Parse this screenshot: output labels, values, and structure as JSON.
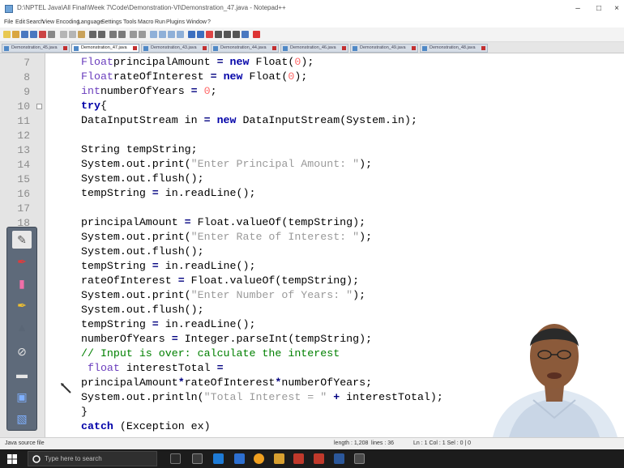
{
  "window": {
    "title": "D:\\NPTEL Java\\All Final\\Week 7\\Code\\Demonstration-VI\\Demonstration_47.java - Notepad++",
    "min": "–",
    "max": "□",
    "close": "×"
  },
  "menu": [
    "File",
    "Edit",
    "Search",
    "View",
    "Encoding",
    "Language",
    "Settings",
    "Tools",
    "Macro",
    "Run",
    "Plugins",
    "Window",
    "?"
  ],
  "tabs": [
    {
      "label": "Demonstration_45.java"
    },
    {
      "label": "Demonstration_47.java"
    },
    {
      "label": "Demonstration_43.java"
    },
    {
      "label": "Demonstration_44.java"
    },
    {
      "label": "Demonstration_46.java"
    },
    {
      "label": "Demonstration_49.java"
    },
    {
      "label": "Demonstration_48.java"
    }
  ],
  "lines": [
    {
      "n": "7",
      "code": [
        [
          "ty",
          "Float"
        ],
        [
          "",
          "principalAmount "
        ],
        [
          "op",
          "="
        ],
        [
          "",
          " "
        ],
        [
          "kw",
          "new"
        ],
        [
          "",
          " Float("
        ],
        [
          "num",
          "0"
        ],
        [
          "",
          ");"
        ]
      ]
    },
    {
      "n": "8",
      "code": [
        [
          "ty",
          "Float"
        ],
        [
          "",
          "rateOfInterest "
        ],
        [
          "op",
          "="
        ],
        [
          "",
          " "
        ],
        [
          "kw",
          "new"
        ],
        [
          "",
          " Float("
        ],
        [
          "num",
          "0"
        ],
        [
          "",
          ");"
        ]
      ]
    },
    {
      "n": "9",
      "code": [
        [
          "ty",
          "int"
        ],
        [
          "",
          "numberOfYears "
        ],
        [
          "op",
          "="
        ],
        [
          "",
          " "
        ],
        [
          "num",
          "0"
        ],
        [
          "",
          ";"
        ]
      ]
    },
    {
      "n": "10",
      "code": [
        [
          "kw",
          "try"
        ],
        [
          "",
          "{"
        ]
      ]
    },
    {
      "n": "11",
      "code": [
        [
          "",
          "DataInputStream in "
        ],
        [
          "op",
          "="
        ],
        [
          "",
          " "
        ],
        [
          "kw",
          "new"
        ],
        [
          "",
          " DataInputStream(System.in);"
        ]
      ]
    },
    {
      "n": "12",
      "code": []
    },
    {
      "n": "13",
      "code": [
        [
          "",
          "String tempString;"
        ]
      ]
    },
    {
      "n": "14",
      "code": [
        [
          "",
          "System.out.print("
        ],
        [
          "str",
          "\"Enter Principal Amount: \""
        ],
        [
          "",
          ");"
        ]
      ]
    },
    {
      "n": "15",
      "code": [
        [
          "",
          "System.out.flush();"
        ]
      ]
    },
    {
      "n": "16",
      "code": [
        [
          "",
          "tempString "
        ],
        [
          "op",
          "="
        ],
        [
          "",
          " in.readLine();"
        ]
      ]
    },
    {
      "n": "17",
      "code": []
    },
    {
      "n": "18",
      "code": [
        [
          "",
          "principalAmount "
        ],
        [
          "op",
          "="
        ],
        [
          "",
          " Float.valueOf(tempString);"
        ]
      ]
    },
    {
      "n": "",
      "code": [
        [
          "",
          "System.out.print("
        ],
        [
          "str",
          "\"Enter Rate of Interest: \""
        ],
        [
          "",
          ");"
        ]
      ]
    },
    {
      "n": "",
      "code": [
        [
          "",
          "System.out.flush();"
        ]
      ]
    },
    {
      "n": "",
      "code": [
        [
          "",
          "tempString "
        ],
        [
          "op",
          "="
        ],
        [
          "",
          " in.readLine();"
        ]
      ]
    },
    {
      "n": "",
      "code": [
        [
          "",
          "rateOfInterest "
        ],
        [
          "op",
          "="
        ],
        [
          "",
          " Float.valueOf(tempString);"
        ]
      ]
    },
    {
      "n": "",
      "code": [
        [
          "",
          "System.out.print("
        ],
        [
          "str",
          "\"Enter Number of Years: \""
        ],
        [
          "",
          ");"
        ]
      ]
    },
    {
      "n": "",
      "code": [
        [
          "",
          "System.out.flush();"
        ]
      ]
    },
    {
      "n": "",
      "code": [
        [
          "",
          "tempString "
        ],
        [
          "op",
          "="
        ],
        [
          "",
          " in.readLine();"
        ]
      ]
    },
    {
      "n": "",
      "code": [
        [
          "",
          "numberOfYears "
        ],
        [
          "op",
          "="
        ],
        [
          "",
          " Integer.parseInt(tempString);"
        ]
      ]
    },
    {
      "n": "",
      "code": [
        [
          "cm",
          "// Input is over: calculate the interest"
        ]
      ]
    },
    {
      "n": "",
      "code": [
        [
          "",
          " "
        ],
        [
          "ty",
          "float"
        ],
        [
          "",
          " interestTotal "
        ],
        [
          "op",
          "="
        ]
      ]
    },
    {
      "n": "",
      "code": [
        [
          "",
          "principalAmount"
        ],
        [
          "op",
          "*"
        ],
        [
          "",
          "rateOfInterest"
        ],
        [
          "op",
          "*"
        ],
        [
          "",
          "numberOfYears;"
        ]
      ]
    },
    {
      "n": "",
      "code": [
        [
          "",
          "System.out.println("
        ],
        [
          "str",
          "\"Total Interest = \""
        ],
        [
          "",
          " "
        ],
        [
          "op",
          "+"
        ],
        [
          "",
          " interestTotal);"
        ]
      ]
    },
    {
      "n": "",
      "code": [
        [
          "",
          "}"
        ]
      ]
    },
    {
      "n": "",
      "code": [
        [
          "kw",
          "catch"
        ],
        [
          "",
          " (Exception ex)"
        ]
      ]
    }
  ],
  "status": {
    "type": "Java source file",
    "length": "length : 1,208",
    "lines": "lines : 36",
    "position": "Ln : 1    Col : 1    Sel : 0 | 0"
  },
  "taskbar": {
    "search_placeholder": "Type here to search"
  },
  "colors": {
    "keyword": "#0000a8",
    "type": "#6a3dbd",
    "number": "#ff6a6a",
    "string": "#9a9a9a",
    "comment": "#008000",
    "gutter": "#e4e4e4"
  },
  "palette_tools": [
    "note-icon",
    "red-pen-icon",
    "pink-highlighter-icon",
    "yellow-highlighter-icon",
    "eraser-icon",
    "clear-icon",
    "minimize-icon",
    "monitor-icon",
    "pen-settings-icon"
  ]
}
